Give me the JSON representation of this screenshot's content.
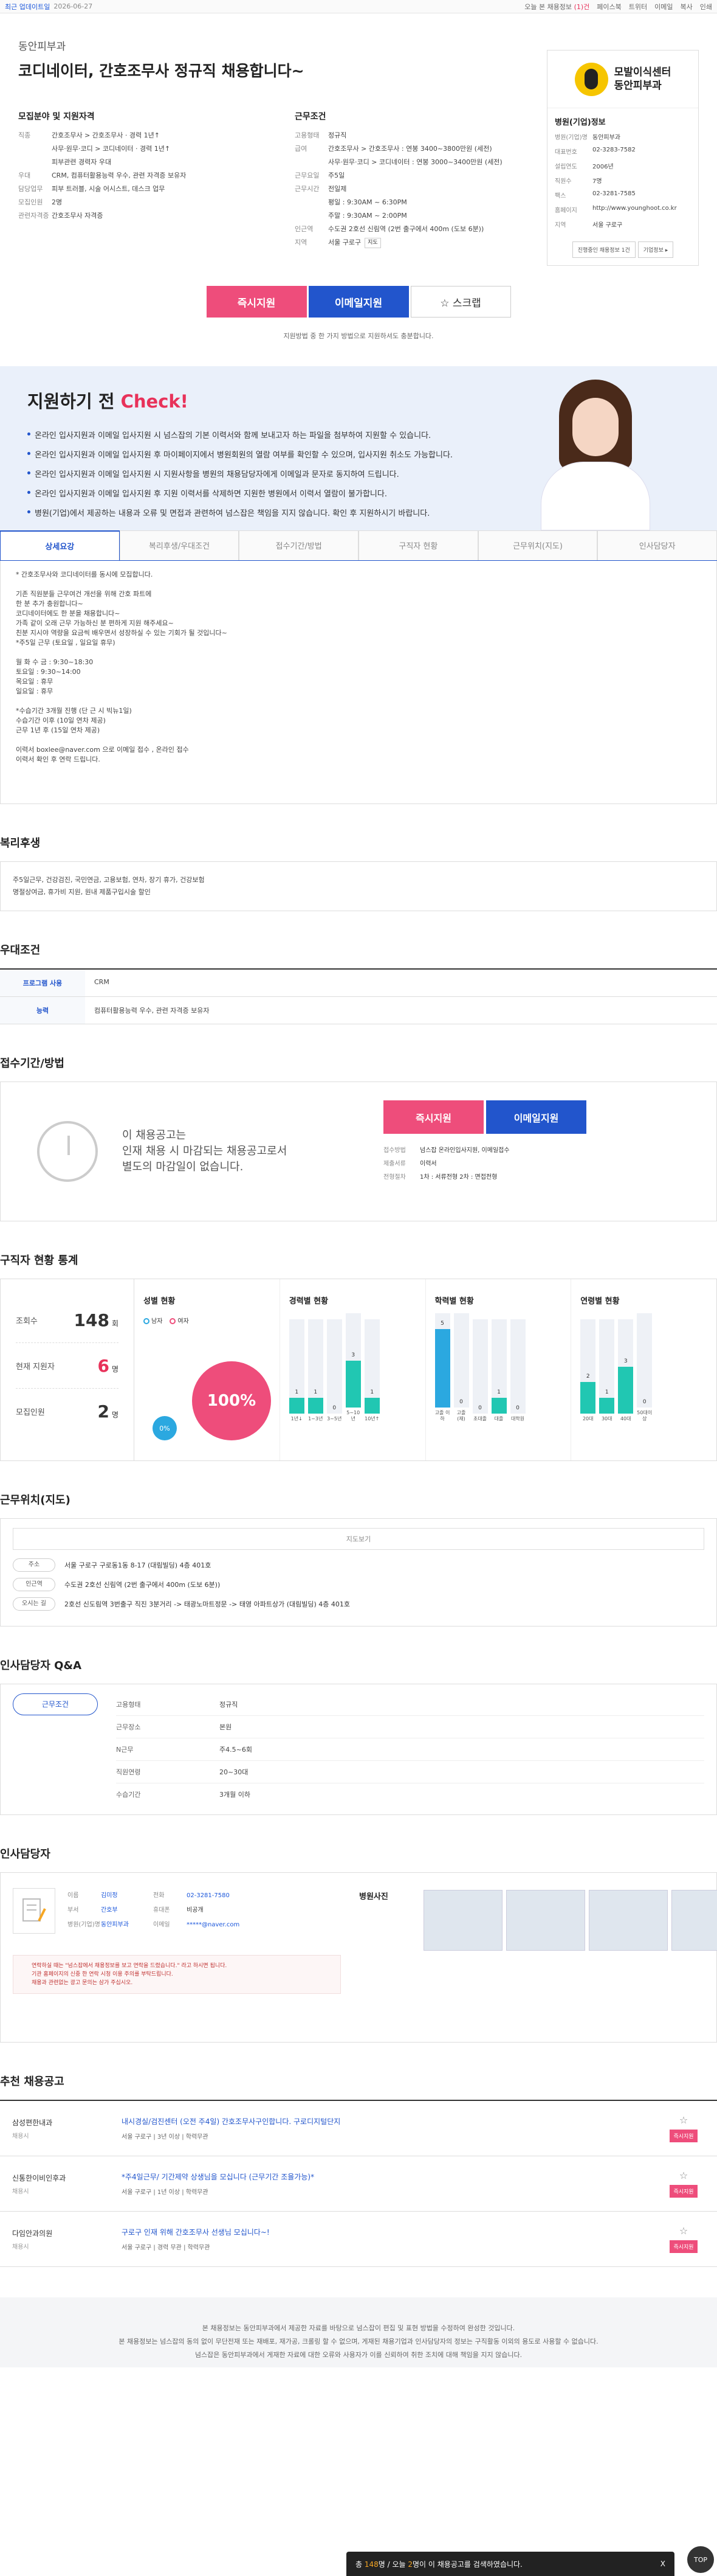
{
  "topbar": {
    "recent": "최근 업데이트일",
    "date": "2026-06-27",
    "today": "오늘 본 채용정보",
    "today_count": "(1)건",
    "links": [
      "페이스북",
      "트위터",
      "이메일",
      "복사",
      "인쇄"
    ]
  },
  "job": {
    "company": "동안피부과",
    "title": "코디네이터, 간호조무사 정규직 채용합니다~"
  },
  "qual": {
    "heading": "모집분야 및 지원자격",
    "rows": [
      {
        "k": "직종",
        "v": "간호조무사 > 간호조무사 · 경력 1년↑"
      },
      {
        "k": "",
        "v": "사무·원무·코디 > 코디네이터 · 경력 1년↑"
      },
      {
        "k": "",
        "v": "피부관련 경력자 우대"
      },
      {
        "k": "우대",
        "v": "CRM, 컴퓨터활용능력 우수, 관련 자격증 보유자"
      },
      {
        "k": "담당업무",
        "v": "피부 트러블, 시술 어시스트, 데스크 업무"
      },
      {
        "k": "모집인원",
        "v": "2명"
      },
      {
        "k": "관련자격증",
        "v": "간호조무사 자격증"
      }
    ]
  },
  "cond": {
    "heading": "근무조건",
    "rows": [
      {
        "k": "고용형태",
        "v": "정규직"
      },
      {
        "k": "급여",
        "v": "간호조무사 > 간호조무사 : 연봉 3400~3800만원 (세전)"
      },
      {
        "k": "",
        "v": "사무·원무·코디 > 코디네이터 : 연봉 3000~3400만원 (세전)"
      },
      {
        "k": "근무요일",
        "v": "주5일"
      },
      {
        "k": "근무시간",
        "v": "전일제"
      },
      {
        "k": "",
        "v": "평일 : 9:30AM ~ 6:30PM"
      },
      {
        "k": "",
        "v": "주말 : 9:30AM ~ 2:00PM"
      },
      {
        "k": "인근역",
        "v": "수도권 2호선 신림역 (2번 출구에서 400m (도보 6분))"
      },
      {
        "k": "지역",
        "v": "서울 구로구"
      }
    ],
    "map": "지도"
  },
  "hospital": {
    "logo1": "모발이식센터",
    "logo2": "동안피부과",
    "heading": "병원(기업)정보",
    "rows": [
      {
        "k": "병원(기업)명",
        "v": "동안피부과"
      },
      {
        "k": "대표번호",
        "v": "02-3283-7582"
      },
      {
        "k": "설립연도",
        "v": "2006년"
      },
      {
        "k": "직원수",
        "v": "7명"
      },
      {
        "k": "팩스",
        "v": "02-3281-7585"
      },
      {
        "k": "홈페이지",
        "v": "http://www.younghoot.co.kr"
      },
      {
        "k": "지역",
        "v": "서울 구로구"
      }
    ],
    "btn1": "진행중인 채용정보 1건",
    "btn2": "기업정보 ▸"
  },
  "apply": {
    "now": "즉시지원",
    "email": "이메일지원",
    "scrap": "☆  스크랩",
    "note": "지원방법 중 한 가지 방법으로 지원하셔도 충분합니다."
  },
  "check": {
    "title_a": "지원하기 전 ",
    "title_b": "Check!",
    "items": [
      "온라인 입사지원과 이메일 입사지원 시 넘스잡의 기본 이력서와 함께 보내고자 하는 파일을 첨부하여 지원할 수 있습니다.",
      "온라인 입사지원과 이메일 입사지원 후 마이페이지에서 병원회원의 열람 여부를 확인할 수 있으며, 입사지원 취소도 가능합니다.",
      "온라인 입사지원과 이메일 입사지원 시 지원사항을 병원의 채용담당자에게 이메일과 문자로 동지하여 드립니다.",
      "온라인 입사지원과 이메일 입사지원 후 지원 이력서를 삭제하면 지원한 병원에서 이력서 열람이 불가합니다.",
      "병원(기업)에서 제공하는 내용과 오류 및 면접과 관련하여 넘스잡은 책임을 지지 않습니다. 확인 후 지원하시기 바랍니다."
    ]
  },
  "tabs": [
    "상세요강",
    "복리후생/우대조건",
    "접수기간/방법",
    "구직자 현황",
    "근무위치(지도)",
    "인사담당자"
  ],
  "detail": {
    "lines": [
      "* 간호조무사와 코디네이터를 동시에 모집합니다.",
      "",
      "기존 직원분들 근무여건 개선을 위해 간호 파트에",
      "한 분 추가 충원합니다~",
      "코디네이터에도 한 분을 채용합니다~",
      "가족 같이 오래 근무 가능하신 분 편하게 지원 해주세요~",
      "친분 지시야 역량을 요금씩 배우면서 성장하실 수 있는 기회가 될 것입니다~",
      "*주5일 근무 (토요일 , 일요일 휴무)",
      "",
      " 월 화 수 금 : 9:30~18:30",
      " 토요일 : 9:30~14:00",
      " 목요일 : 휴무",
      " 일요일 : 휴무",
      "",
      "*수습기간 3개월 진행 (단 근 시 빅뉴1일)",
      " 수습기간 이후 (10일 연차 제공)",
      " 근무 1년 후 (15일 연차 제공)",
      "",
      "이력서 boxlee@naver.com 으로 이메일 접수 , 온라인 접수",
      "이력서 확인 후 연락 드립니다."
    ]
  },
  "welfare": {
    "title": "복리후생",
    "lines": [
      "주5일근무, 건강검진, 국민연금, 고용보험, 연차, 장기 휴가, 건강보험",
      "명절상여금, 휴가비 지원, 원내 제품구입시술 할인"
    ]
  },
  "pref": {
    "title": "우대조건",
    "rows": [
      {
        "k": "프로그램 사용",
        "v": "CRM"
      },
      {
        "k": "능력",
        "v": "컴퓨터활용능력 우수, 관련 자격증 보유자"
      }
    ]
  },
  "period": {
    "title": "접수기간/방법",
    "msg": [
      "이 채용공고는",
      "인재 채용 시 마감되는 채용공고로서",
      "별도의 마감일이 없습니다."
    ],
    "now": "즉시지원",
    "email": "이메일지원",
    "rows": [
      {
        "k": "접수방법",
        "v": "넘스잡 온라인입사지원, 이메일접수"
      },
      {
        "k": "제출서류",
        "v": "이력서"
      },
      {
        "k": "전형절차",
        "v": "1차 : 서류전형    2차 : 면접전형"
      }
    ]
  },
  "stats": {
    "title": "구직자 현황 통계",
    "left": [
      {
        "k": "조회수",
        "v": "148",
        "u": "회"
      },
      {
        "k": "현재 지원자",
        "v": "6",
        "u": "명"
      },
      {
        "k": "모집인원",
        "v": "2",
        "u": "명"
      }
    ],
    "gender": {
      "title": "성별 현황",
      "male": "남자",
      "female": "여자",
      "female_pct": "100%",
      "male_pct": "0%"
    },
    "career": {
      "title": "경력별 현황",
      "bars": [
        {
          "l": "1년↓",
          "v": 1
        },
        {
          "l": "1~3년",
          "v": 1
        },
        {
          "l": "3~5년",
          "v": 0
        },
        {
          "l": "5~10년",
          "v": 3
        },
        {
          "l": "10년↑",
          "v": 1
        }
      ]
    },
    "edu": {
      "title": "학력별 현황",
      "bars": [
        {
          "l": "고졸\n이하",
          "v": 5
        },
        {
          "l": "고졸(재)",
          "v": 0
        },
        {
          "l": "초대졸",
          "v": 0
        },
        {
          "l": "대졸",
          "v": 1
        },
        {
          "l": "대학원",
          "v": 0
        }
      ]
    },
    "age": {
      "title": "연령별 현황",
      "bars": [
        {
          "l": "20대",
          "v": 2
        },
        {
          "l": "30대",
          "v": 1
        },
        {
          "l": "40대",
          "v": 3
        },
        {
          "l": "50대이상",
          "v": 0
        }
      ]
    }
  },
  "location": {
    "title": "근무위치(지도)",
    "btn": "지도보기",
    "rows": [
      {
        "k": "주소",
        "v": "서울 구로구 구로동1동 8-17 (대림빌딩) 4층 401호"
      },
      {
        "k": "인근역",
        "v": "수도권 2호선 신림역 (2번 출구에서 400m (도보 6분))"
      },
      {
        "k": "오시는 길",
        "v": "2호선 신도림역 3번출구 직진 3분거리 -> 태광노마트정문 -> 태영 아파트상가 (대림빌딩) 4층 401호"
      }
    ]
  },
  "qa": {
    "title": "인사담당자 Q&A",
    "tab": "근무조건",
    "rows": [
      {
        "k": "고용형태",
        "v": "정규직"
      },
      {
        "k": "근무장소",
        "v": "본원"
      },
      {
        "k": "N근무",
        "v": "주4.5~6회"
      },
      {
        "k": "직원연령",
        "v": "20~30대"
      },
      {
        "k": "수습기간",
        "v": "3개월 이하"
      }
    ]
  },
  "manager": {
    "title": "인사담당자",
    "col1": [
      {
        "k": "이름",
        "v": "김미정"
      },
      {
        "k": "부서",
        "v": "간호부"
      },
      {
        "k": "병원(기업)명",
        "v": "동안피부과"
      }
    ],
    "col2": [
      {
        "k": "전화",
        "v": "02-3281-7580"
      },
      {
        "k": "휴대폰",
        "v": "비공개"
      },
      {
        "k": "이메일",
        "v": "*****@naver.com"
      }
    ],
    "warn": [
      "연락하실 때는 \"넘스잡에서 채용정보를 보고 연락을 드렸습니다.\" 라고 하시면 됩니다.",
      "기관 홈페이지의 신중 한 연락 시청 이용 주의를 부탁드립니다.",
      "채용과 관련없는 광고 문의는 삼가 주십시오."
    ],
    "photos": "병원사진"
  },
  "recommend": {
    "title": "추천 채용공고",
    "items": [
      {
        "c": "삼성편한내과",
        "s": "채용시",
        "t": "내시경실/검진센터 (오전 주4일) 간호조무사구인합니다. 구로디지털단지",
        "d": "서울 구로구  |  3년 이상  |  학력무관"
      },
      {
        "c": "신통한이비인후과",
        "s": "채용시",
        "t": "*주4일근무/ 기간제약 상생님을 모십니다 (근무기간 조율가능)*",
        "d": "서울 구로구  |  1년 이상  |  학력무관"
      },
      {
        "c": "다임안과의원",
        "s": "채용시",
        "t": "구로구 인재 위해 간호조무사 선생님 모십니다~!",
        "d": "서울 구로구  |  경력 무관  |  학력무관"
      }
    ],
    "btn": "즉시지원"
  },
  "footer": {
    "lines": [
      "본 채용정보는 동안피부과에서 제공한 자료를 바탕으로 넘스잡이 편집 및 표현 방법을 수정하여 완성한 것입니다.",
      "본 채용정보는 넘스잡의 동의 없이 무단전재 또는 재배포, 재가공, 크롤링 할 수 없으며, 게재된 채용기업과 인사담당자의 정보는 구직활동 이외의 용도로 사용할 수 없습니다.",
      "넘스잡은 동안피부과에서 게재한 자료에 대한 오류와 사용자가 이를 신뢰하여 취한 조치에 대해 책임을 지지 않습니다."
    ]
  },
  "float": {
    "pre": "총 ",
    "count": "148",
    "mid": "명 / 오늘 ",
    "today": "2",
    "post": "명이 이 채용공고를 검색하였습니다.",
    "close": "X",
    "top": "TOP"
  }
}
